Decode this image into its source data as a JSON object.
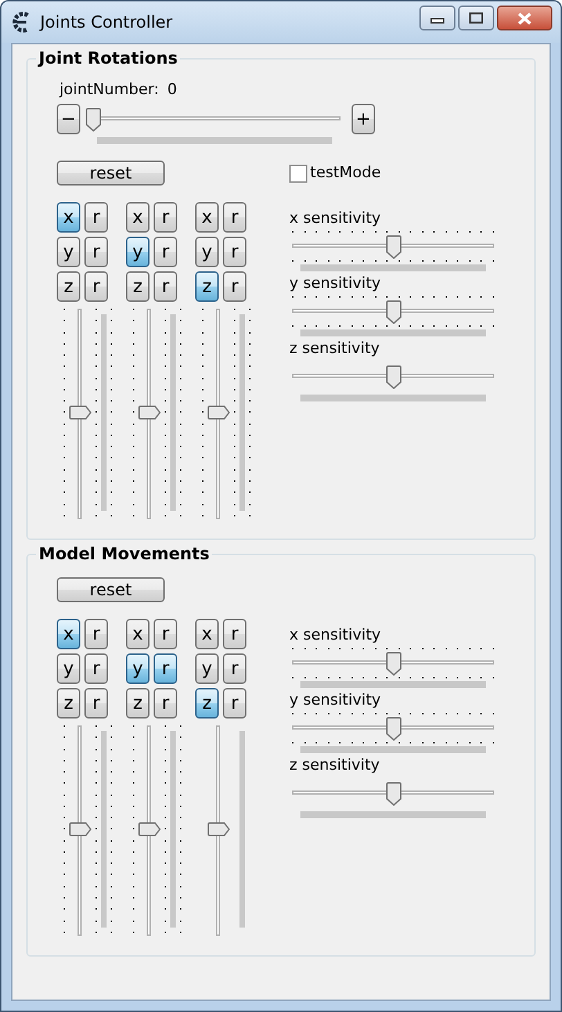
{
  "window": {
    "title": "Joints Controller"
  },
  "sections": [
    {
      "title": "Joint Rotations",
      "joint": {
        "label": "jointNumber:",
        "value": "0",
        "minus": "−",
        "plus": "+",
        "level": 0
      },
      "reset": "reset",
      "test_mode": {
        "label": "testMode",
        "checked": false
      },
      "columns": [
        {
          "rows": [
            [
              {
                "label": "x",
                "selected": true
              },
              {
                "label": "r",
                "selected": false
              }
            ],
            [
              {
                "label": "y",
                "selected": false
              },
              {
                "label": "r",
                "selected": false
              }
            ],
            [
              {
                "label": "z",
                "selected": false
              },
              {
                "label": "r",
                "selected": false
              }
            ]
          ],
          "level": 0.5,
          "ticks": true
        },
        {
          "rows": [
            [
              {
                "label": "x",
                "selected": false
              },
              {
                "label": "r",
                "selected": false
              }
            ],
            [
              {
                "label": "y",
                "selected": true
              },
              {
                "label": "r",
                "selected": false
              }
            ],
            [
              {
                "label": "z",
                "selected": false
              },
              {
                "label": "r",
                "selected": false
              }
            ]
          ],
          "level": 0.5,
          "ticks": true
        },
        {
          "rows": [
            [
              {
                "label": "x",
                "selected": false
              },
              {
                "label": "r",
                "selected": false
              }
            ],
            [
              {
                "label": "y",
                "selected": false
              },
              {
                "label": "r",
                "selected": false
              }
            ],
            [
              {
                "label": "z",
                "selected": true
              },
              {
                "label": "r",
                "selected": false
              }
            ]
          ],
          "level": 0.5,
          "ticks": true
        }
      ],
      "sensitivities": [
        {
          "label": "x sensitivity",
          "level": 0.5,
          "ticks": true
        },
        {
          "label": "y sensitivity",
          "level": 0.5,
          "ticks": true
        },
        {
          "label": "z sensitivity",
          "level": 0.5,
          "ticks": false
        }
      ]
    },
    {
      "title": "Model Movements",
      "reset": "reset",
      "columns": [
        {
          "rows": [
            [
              {
                "label": "x",
                "selected": true
              },
              {
                "label": "r",
                "selected": false
              }
            ],
            [
              {
                "label": "y",
                "selected": false
              },
              {
                "label": "r",
                "selected": false
              }
            ],
            [
              {
                "label": "z",
                "selected": false
              },
              {
                "label": "r",
                "selected": false
              }
            ]
          ],
          "level": 0.5,
          "ticks": true
        },
        {
          "rows": [
            [
              {
                "label": "x",
                "selected": false
              },
              {
                "label": "r",
                "selected": false
              }
            ],
            [
              {
                "label": "y",
                "selected": true
              },
              {
                "label": "r",
                "selected": true
              }
            ],
            [
              {
                "label": "z",
                "selected": false
              },
              {
                "label": "r",
                "selected": false
              }
            ]
          ],
          "level": 0.5,
          "ticks": true
        },
        {
          "rows": [
            [
              {
                "label": "x",
                "selected": false
              },
              {
                "label": "r",
                "selected": false
              }
            ],
            [
              {
                "label": "y",
                "selected": false
              },
              {
                "label": "r",
                "selected": false
              }
            ],
            [
              {
                "label": "z",
                "selected": true
              },
              {
                "label": "r",
                "selected": false
              }
            ]
          ],
          "level": 0.5,
          "ticks": false
        }
      ],
      "sensitivities": [
        {
          "label": "x sensitivity",
          "level": 0.5,
          "ticks": true
        },
        {
          "label": "y sensitivity",
          "level": 0.5,
          "ticks": true
        },
        {
          "label": "z sensitivity",
          "level": 0.5,
          "ticks": false
        }
      ]
    }
  ]
}
